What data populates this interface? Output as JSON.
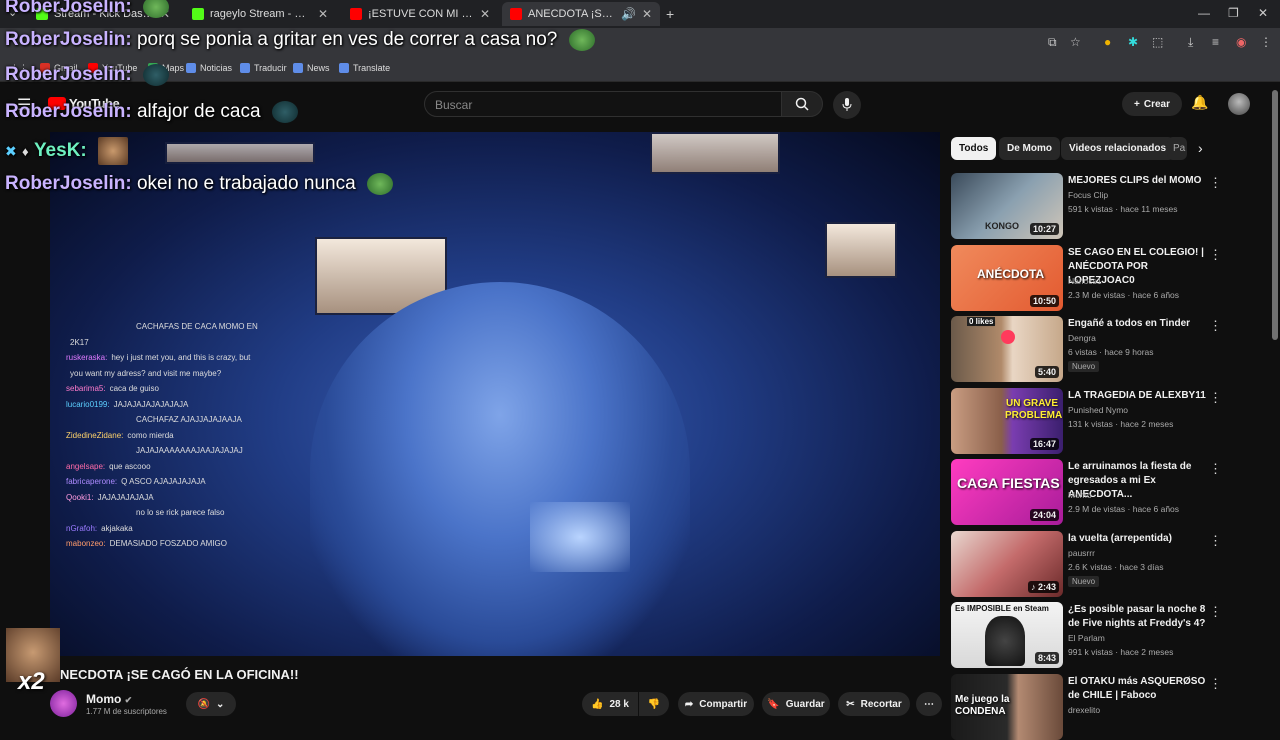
{
  "browser": {
    "tabs": [
      {
        "label": "Stream - Kick Dashboard",
        "color": "#53fc18"
      },
      {
        "label": "rageylo Stream - Watch Live on Kick",
        "color": "#53fc18"
      },
      {
        "label": "¡ESTUVE CON MI PROFESORA",
        "color": "#ff0000"
      },
      {
        "label": "ANECDOTA ¡SE CAGÓ EN LA OFICINA",
        "color": "#ff0000"
      }
    ],
    "bookmarks": [
      "Gmail",
      "YouTube",
      "Maps",
      "Noticias",
      "Traducir",
      "News",
      "Translate"
    ]
  },
  "overlay_chat": [
    {
      "name": "RoberJoselin:",
      "message": ""
    },
    {
      "name": "RoberJoselin:",
      "message": "porq se ponia a gritar en ves de correr a casa no?"
    },
    {
      "name": "RoberJoselin:",
      "message": ""
    },
    {
      "name": "RoberJoselin:",
      "message": "alfajor de caca"
    },
    {
      "name": "YesK:",
      "message": ""
    },
    {
      "name": "RoberJoselin:",
      "message": "okei no e trabajado nunca"
    }
  ],
  "youtube": {
    "search_placeholder": "Buscar",
    "create_label": "Crear",
    "video_title": "NECDOTA ¡SE CAGÓ EN LA OFICINA!!",
    "channel_name": "Momo",
    "subscribers": "1.77 M de suscriptores",
    "likes": "28 k",
    "share_label": "Compartir",
    "save_label": "Guardar",
    "clip_label": "Recortar",
    "webcam_badge": "x2"
  },
  "stream_chat": [
    {
      "user": "",
      "user_color": "#7b6cff",
      "message": "CACHAFAS DE CACA MOMO EN"
    },
    {
      "user": "",
      "user_color": "#7b6cff",
      "message": "2K17"
    },
    {
      "user": "ruskeraska:",
      "user_color": "#e07bff",
      "message": "hey i just met you, and this is crazy, but"
    },
    {
      "user": "",
      "user_color": "#ccc",
      "message": "you want my adress? and visit me maybe?"
    },
    {
      "user": "sebarima5:",
      "user_color": "#ff7bcc",
      "message": "caca de guiso"
    },
    {
      "user": "lucario0199:",
      "user_color": "#5ccfff",
      "message": "JAJAJAJAJAJAJAJA"
    },
    {
      "user": "",
      "user_color": "#7b6cff",
      "message": "CACHAFAZ AJAJJAJAJAAJA"
    },
    {
      "user": "ZidedineZidane:",
      "user_color": "#ffd36b",
      "message": "como mierda"
    },
    {
      "user": "",
      "user_color": "#ff6b6b",
      "message": "JAJAJAAAAAAAJAAJAJAJAJ"
    },
    {
      "user": "angelsape:",
      "user_color": "#ff6ba8",
      "message": "que ascooo"
    },
    {
      "user": "fabricaperone:",
      "user_color": "#ad8bff",
      "message": "Q ASCO AJAJAJAJAJA"
    },
    {
      "user": "Qooki1:",
      "user_color": "#ff9be0",
      "message": "JAJAJAJAJAJA"
    },
    {
      "user": "",
      "user_color": "#7b6cff",
      "message": "no lo se rick parece falso"
    },
    {
      "user": "nGrafoh:",
      "user_color": "#9b7bff",
      "message": "akjakaka"
    },
    {
      "user": "mabonzeo:",
      "user_color": "#ff9b6b",
      "message": "DEMASIADO FOSZADO AMIGO"
    }
  ],
  "sidebar": {
    "chips": [
      "Todos",
      "De Momo",
      "Videos relacionados",
      "Pa"
    ],
    "videos": [
      {
        "title": "MEJORES CLIPS del MOMO",
        "channel": "Focus Clip",
        "meta": "591 k vistas · hace 11 meses",
        "duration": "10:27",
        "thumb_text": "KONGO",
        "badge": ""
      },
      {
        "title": "SE CAGO EN EL COLEGIO! | ANÉCDOTA POR LOPEZJOAC0",
        "channel": "Nanocs1",
        "meta": "2.3 M de vistas · hace 6 años",
        "duration": "10:50",
        "thumb_text": "ANÉCDOTA",
        "badge": ""
      },
      {
        "title": "Engañé a todos en Tinder",
        "channel": "Dengra",
        "meta": "6 vistas · hace 9 horas",
        "duration": "5:40",
        "thumb_text": "0 likes",
        "badge": "Nuevo"
      },
      {
        "title": "LA TRAGEDIA DE ALEXBY11",
        "channel": "Punished Nymo",
        "meta": "131 k vistas · hace 2 meses",
        "duration": "16:47",
        "thumb_text": "UN GRAVE PROBLEMA",
        "badge": ""
      },
      {
        "title": "Le arruinamos la fiesta de egresados a mi Ex ANECDOTA...",
        "channel": "Momo",
        "meta": "2.9 M de vistas · hace 6 años",
        "duration": "24:04",
        "thumb_text": "CAGA FIESTAS",
        "badge": ""
      },
      {
        "title": "la vuelta (arrepentida)",
        "channel": "pausrrr",
        "meta": "2.6 K vistas · hace 3 días",
        "duration": "2:43",
        "thumb_text": "",
        "badge": "Nuevo"
      },
      {
        "title": "¿Es posible pasar la noche 8 de Five nights at Freddy's 4?",
        "channel": "El Parlam",
        "meta": "991 k vistas · hace 2 meses",
        "duration": "8:43",
        "thumb_text": "Es IMPOSIBLE en Steam",
        "badge": ""
      },
      {
        "title": "El OTAKU más ASQUERØSO de CHILE | Faboco",
        "channel": "drexelito",
        "meta": "",
        "duration": "",
        "thumb_text": "Me juego la CONDENA",
        "badge": ""
      }
    ]
  }
}
